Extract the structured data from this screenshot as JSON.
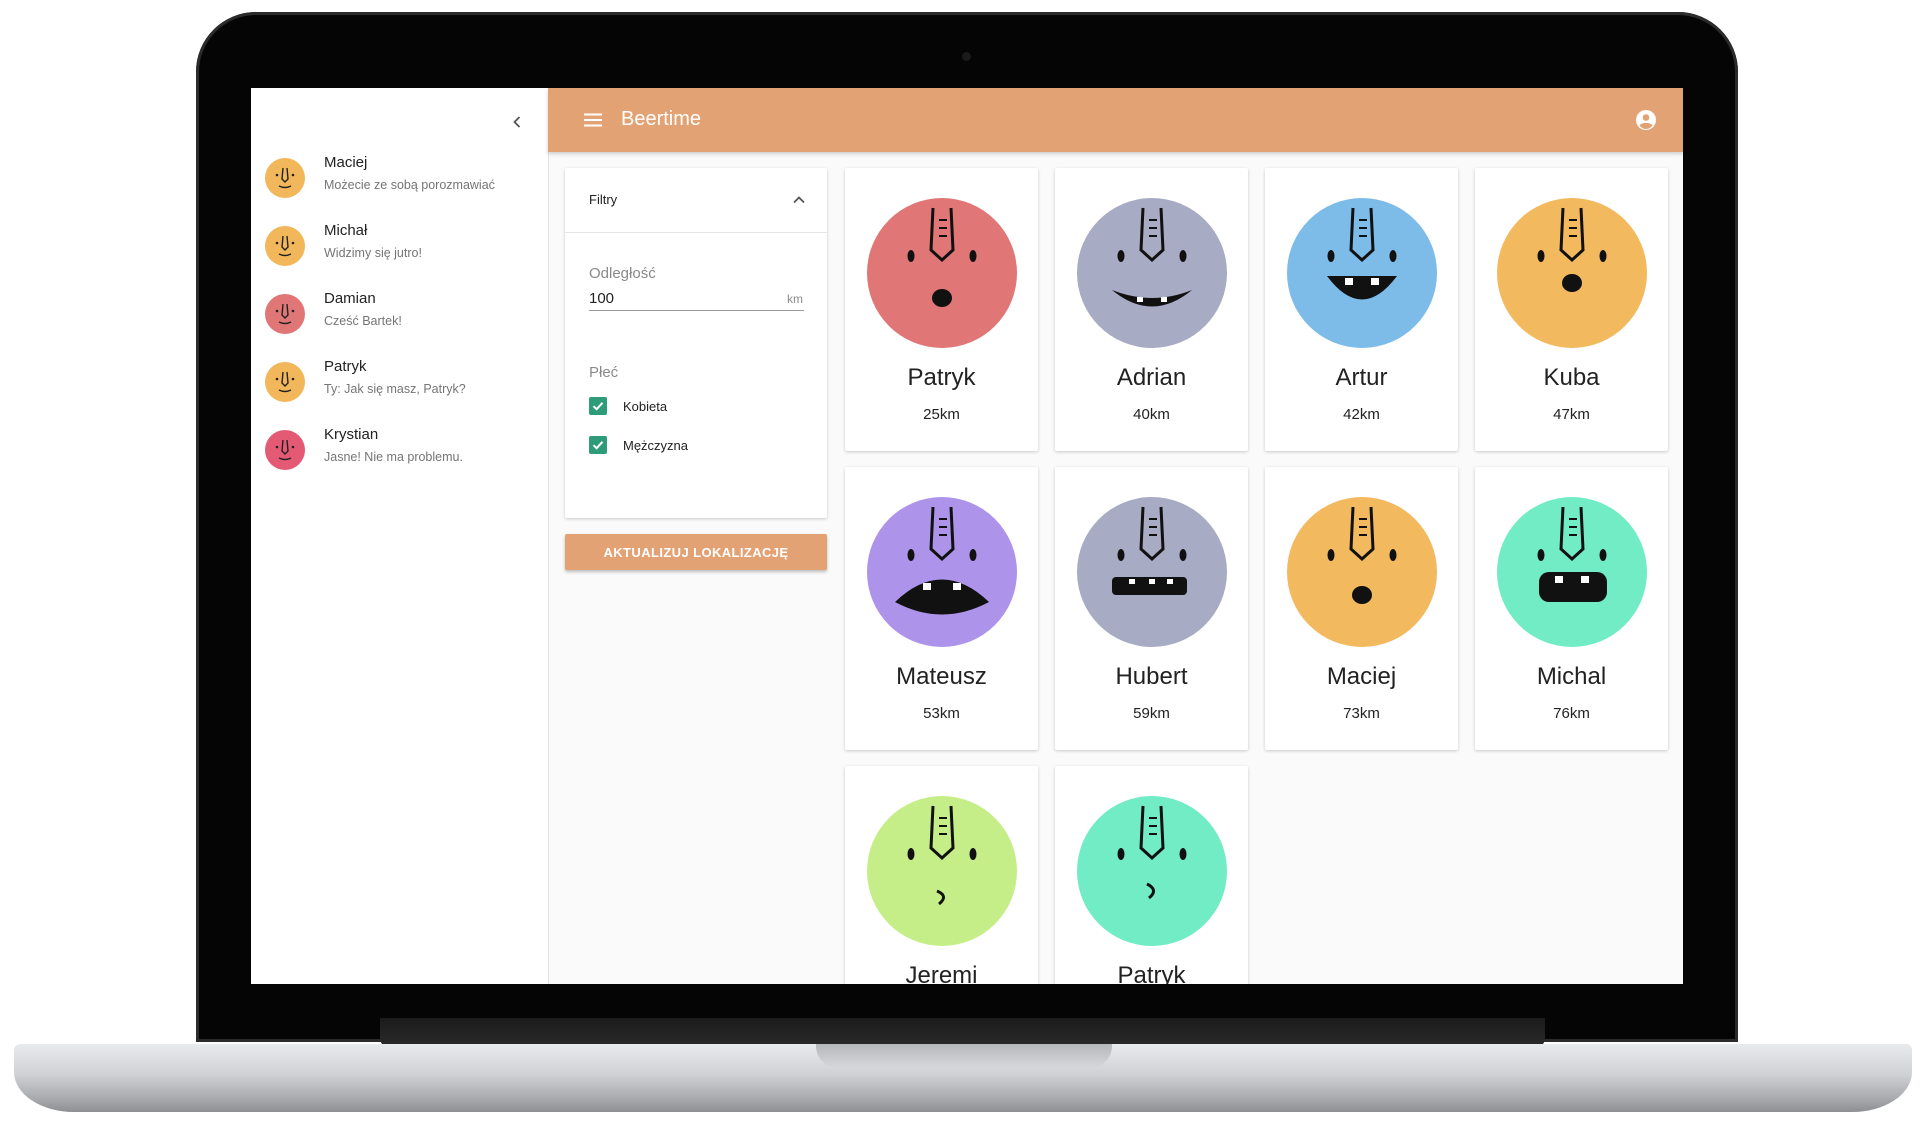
{
  "app": {
    "title": "Beertime"
  },
  "drawer": {
    "chats": [
      {
        "name": "Maciej",
        "message": "Możecie ze sobą porozmawiać",
        "color": "#f2b75a"
      },
      {
        "name": "Michał",
        "message": "Widzimy się jutro!",
        "color": "#f2b75a"
      },
      {
        "name": "Damian",
        "message": "Cześć Bartek!",
        "color": "#e07676"
      },
      {
        "name": "Patryk",
        "message": "Ty: Jak się masz, Patryk?",
        "color": "#f2b75a"
      },
      {
        "name": "Krystian",
        "message": "Jasne! Nie ma problemu.",
        "color": "#e45a75"
      }
    ]
  },
  "filters": {
    "title": "Filtry",
    "distance_label": "Odległość",
    "distance_value": "100",
    "distance_unit": "km",
    "gender_label": "Płeć",
    "options": [
      {
        "label": "Kobieta",
        "checked": true
      },
      {
        "label": "Mężczyzna",
        "checked": true
      }
    ],
    "update_button": "AKTUALIZUJ LOKALIZACJĘ"
  },
  "profiles": [
    {
      "name": "Patryk",
      "distance": "25km",
      "color": "#e07676"
    },
    {
      "name": "Adrian",
      "distance": "40km",
      "color": "#a8abc4"
    },
    {
      "name": "Artur",
      "distance": "42km",
      "color": "#7dbbe8"
    },
    {
      "name": "Kuba",
      "distance": "47km",
      "color": "#f3b95e"
    },
    {
      "name": "Mateusz",
      "distance": "53km",
      "color": "#ad94ea"
    },
    {
      "name": "Hubert",
      "distance": "59km",
      "color": "#a8abc4"
    },
    {
      "name": "Maciej",
      "distance": "73km",
      "color": "#f3b95e"
    },
    {
      "name": "Michal",
      "distance": "76km",
      "color": "#72ecc4"
    },
    {
      "name": "Jeremi",
      "distance": "",
      "color": "#c6ee88"
    },
    {
      "name": "Patryk",
      "distance": "",
      "color": "#72ecc4"
    }
  ],
  "icons": {
    "collapse": "chevron-left-icon",
    "menu": "hamburger-menu-icon",
    "account": "account-circle-icon",
    "expand": "chevron-up-icon",
    "check": "checkmark-icon"
  }
}
